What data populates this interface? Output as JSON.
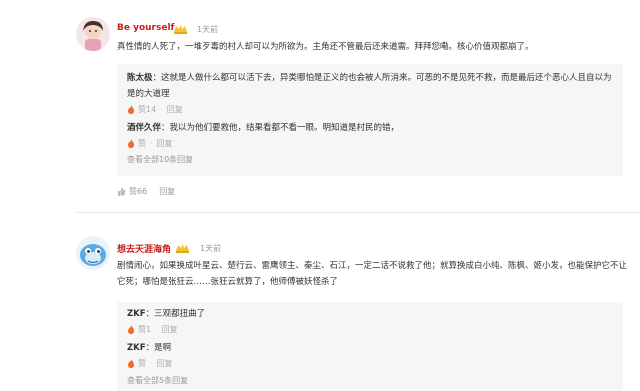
{
  "comments": [
    {
      "username": "Be yourself",
      "time": "1天前",
      "text": "真性情的人死了，一堆歹毒的村人却可以为所欲为。主角还不管最后还来道需。拜拜您嘞。核心价值观都崩了。",
      "replies": [
        {
          "name": "陈太极",
          "text": "：这就是人做什么都可以活下去，异类哪怕是正义的也会被人所消来。可恶的不是见死不救，而是最后还个恶心人且自以为是的大道理",
          "likes": "赞14",
          "reply_label": "回复"
        },
        {
          "name": "酒伴久伴",
          "text": "：我以为他们要救他，结果看都不看一眼。明知道是村民的错，",
          "likes": "赞",
          "reply_label": "回复"
        }
      ],
      "view_all": "查看全部10条回复",
      "likes": "赞66",
      "reply_label": "回复"
    },
    {
      "username": "想去天涯海角",
      "time": "1天前",
      "text": "剧情闹心，如果换成叶星云、楚行云、雷鹰领主、秦尘、石江，一定二话不说救了他；就算换成白小纯、陈枫、姬小发，也能保护它不让它死；哪怕是张狂云……张狂云就算了，他师傅被妖怪杀了",
      "replies": [
        {
          "name": "ZKF",
          "text": "：三观都扭曲了",
          "likes": "赞1",
          "reply_label": "回复"
        },
        {
          "name": "ZKF",
          "text": "：是啊",
          "likes": "赞",
          "reply_label": "回复"
        }
      ],
      "view_all": "查看全部5条回复"
    }
  ],
  "colors": {
    "username": "#c8211b",
    "like_fire": "#f06a2c",
    "reply_bg": "#f6f6f6"
  },
  "icons": {
    "vip": "vip-badge-icon",
    "like": "fire-like-icon",
    "main_like": "thumb-icon"
  }
}
